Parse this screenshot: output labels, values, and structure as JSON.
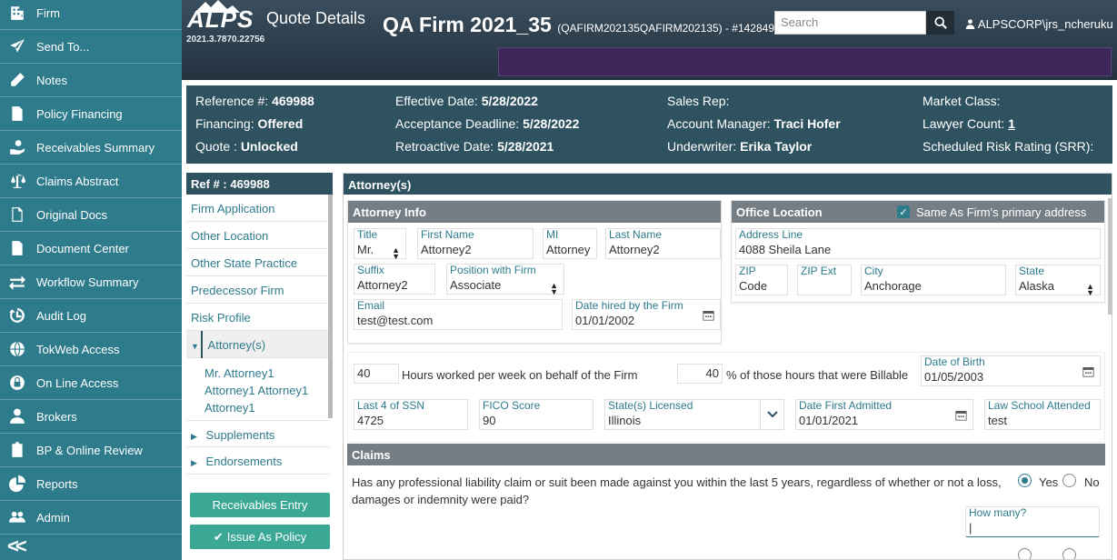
{
  "sidebar": {
    "items": [
      {
        "label": "Firm",
        "icon": "building-icon"
      },
      {
        "label": "Send To...",
        "icon": "paper-plane-icon"
      },
      {
        "label": "Notes",
        "icon": "pencil-icon"
      },
      {
        "label": "Policy Financing",
        "icon": "invoice-icon"
      },
      {
        "label": "Receivables Summary",
        "icon": "hand-money-icon"
      },
      {
        "label": "Claims Abstract",
        "icon": "scale-icon"
      },
      {
        "label": "Original Docs",
        "icon": "file-icon"
      },
      {
        "label": "Document Center",
        "icon": "document-icon"
      },
      {
        "label": "Workflow Summary",
        "icon": "exchange-icon"
      },
      {
        "label": "Audit Log",
        "icon": "history-icon"
      },
      {
        "label": "TokWeb Access",
        "icon": "globe-icon"
      },
      {
        "label": "On Line Access",
        "icon": "lock-globe-icon"
      },
      {
        "label": "Brokers",
        "icon": "user-icon"
      },
      {
        "label": "BP & Online Review",
        "icon": "clipboard-icon"
      },
      {
        "label": "Reports",
        "icon": "pie-chart-icon"
      },
      {
        "label": "Admin",
        "icon": "users-icon"
      }
    ],
    "collapse_label": "<<"
  },
  "header": {
    "logo": "ALPS",
    "version": "2021.3.7870.22756",
    "page_title": "Quote Details",
    "firm_name": "QA Firm 2021_35",
    "firm_sub": "(QAFIRM202135QAFIRM202135) - #142849",
    "search_placeholder": "Search",
    "user": "ALPSCORP\\jrs_ncheruku"
  },
  "info": {
    "reference_label": "Reference #:",
    "reference_value": "469988",
    "financing_label": "Financing:",
    "financing_value": "Offered",
    "quote_label": "Quote :",
    "quote_value": "Unlocked",
    "effective_label": "Effective Date:",
    "effective_value": "5/28/2022",
    "acceptance_label": "Acceptance Deadline:",
    "acceptance_value": "5/28/2022",
    "retro_label": "Retroactive Date:",
    "retro_value": "5/28/2021",
    "salesrep_label": "Sales Rep:",
    "acctmgr_label": "Account Manager:",
    "acctmgr_value": "Traci Hofer",
    "underwriter_label": "Underwriter:",
    "underwriter_value": "Erika Taylor",
    "market_label": "Market Class:",
    "lawyer_label": "Lawyer Count:",
    "lawyer_value": "1",
    "srr_label": "Scheduled Risk Rating (SRR):"
  },
  "nav": {
    "ref_header": "Ref # : 469988",
    "items": [
      "Firm Application",
      "Other Location",
      "Other State Practice",
      "Predecessor Firm",
      "Risk Profile"
    ],
    "active": "Attorney(s)",
    "attorneys": [
      "Mr. Attorney1",
      "Attorney1 Attorney1",
      "Attorney1"
    ],
    "supplements": "Supplements",
    "endorsements": "Endorsements",
    "receivables_btn": "Receivables Entry",
    "issue_btn": "Issue As Policy"
  },
  "main": {
    "title": "Attorney(s)",
    "attorney_info": {
      "header": "Attorney Info",
      "title_label": "Title",
      "title_value": "Mr.",
      "first_label": "First Name",
      "first_value": "Attorney2",
      "mi_label": "MI",
      "mi_value": "Attorney",
      "last_label": "Last Name",
      "last_value": "Attorney2",
      "suffix_label": "Suffix",
      "suffix_value": "Attorney2",
      "position_label": "Position with Firm",
      "position_value": "Associate",
      "email_label": "Email",
      "email_value": "test@test.com",
      "hired_label": "Date hired by the Firm",
      "hired_value": "01/01/2002"
    },
    "office": {
      "header": "Office Location",
      "same_label": "Same As Firm's primary address",
      "address_label": "Address Line",
      "address_value": "4088 Sheila Lane",
      "zip_label": "ZIP",
      "zip_value": "Code",
      "zipext_label": "ZIP Ext",
      "city_label": "City",
      "city_value": "Anchorage",
      "state_label": "State",
      "state_value": "Alaska"
    },
    "hours_value": "40",
    "hours_label": "Hours worked per week on behalf of the Firm",
    "billable_value": "40",
    "billable_label": "% of those hours that were Billable",
    "dob_label": "Date of Birth",
    "dob_value": "01/05/2003",
    "ssn_label": "Last 4 of SSN",
    "ssn_value": "4725",
    "fico_label": "FICO Score",
    "fico_value": "90",
    "states_label": "State(s) Licensed",
    "states_value": "Illinois",
    "admitted_label": "Date First Admitted",
    "admitted_value": "01/01/2021",
    "school_label": "Law School Attended",
    "school_value": "test",
    "claims": {
      "header": "Claims",
      "question": "Has any professional liability claim or suit been made against you within the last 5 years, regardless of whether or not a loss, damages or indemnity were paid?",
      "yes": "Yes",
      "no": "No",
      "how_many_label": "How many?"
    }
  },
  "colors": {
    "sidebar": "#2e7b8c",
    "header": "#2f3f4c",
    "info_band": "#2f5260",
    "accent": "#2e7b8c",
    "button": "#3aa895"
  }
}
